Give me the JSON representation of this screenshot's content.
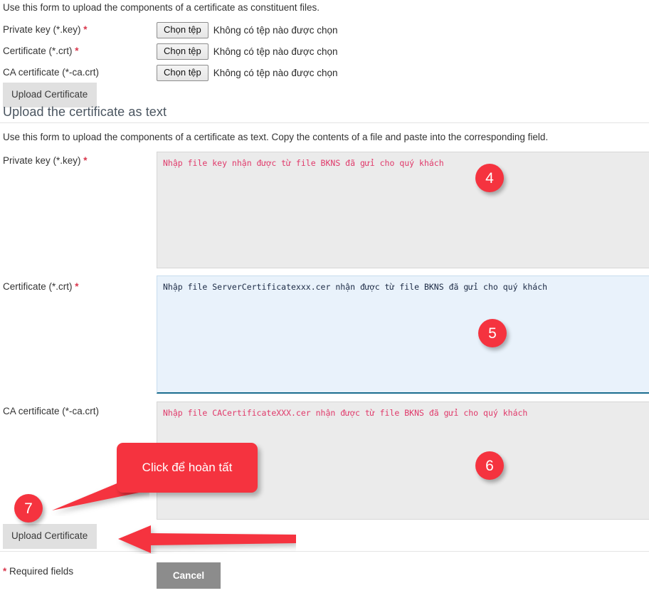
{
  "file_upload_section": {
    "intro": "Use this form to upload the components of a certificate as constituent files.",
    "rows": [
      {
        "label": "Private key (*.key)",
        "required": true,
        "button": "Chọn tệp",
        "status": "Không có tệp nào được chọn"
      },
      {
        "label": "Certificate (*.crt)",
        "required": true,
        "button": "Chọn tệp",
        "status": "Không có tệp nào được chọn"
      },
      {
        "label": "CA certificate (*-ca.crt)",
        "required": false,
        "button": "Chọn tệp",
        "status": "Không có tệp nào được chọn"
      }
    ],
    "submit_label": "Upload Certificate"
  },
  "text_upload_section": {
    "heading": "Upload the certificate as text",
    "intro": "Use this form to upload the components of a certificate as text. Copy the contents of a file and paste into the corresponding field.",
    "fields": [
      {
        "label": "Private key (*.key)",
        "required": true,
        "value": "",
        "placeholder": "Nhập file key nhận được từ file BKNS đã gửi cho quý khách",
        "state": "normal"
      },
      {
        "label": "Certificate (*.crt)",
        "required": true,
        "value": "",
        "placeholder": "Nhập file ServerCertificatexxx.cer nhận được từ file BKNS đã gửi cho quý khách",
        "state": "focused"
      },
      {
        "label": "CA certificate (*-ca.crt)",
        "required": false,
        "value": "",
        "placeholder": "Nhập file CACertificateXXX.cer nhận được từ file BKNS đã gửi cho quý khách",
        "state": "normal"
      }
    ],
    "submit_label": "Upload Certificate"
  },
  "footer": {
    "required_note_star": "*",
    "required_note_text": " Required fields",
    "cancel_label": "Cancel"
  },
  "annotations": {
    "accent_color": "#f5333f",
    "badges": [
      {
        "number": "4"
      },
      {
        "number": "5"
      },
      {
        "number": "6"
      },
      {
        "number": "7"
      }
    ],
    "callout_text": "Click để hoàn tất"
  },
  "colors": {
    "badge_red": "#f5333f",
    "required_star_red": "#d9364c",
    "placeholder_pink": "#e0396a",
    "placeholder_dark": "#1c2a45",
    "textarea_gray": "#ebebeb",
    "textarea_blue": "#e9f2fb",
    "focus_border_teal": "#1b6d8f",
    "button_gray": "#e0e0e0",
    "cancel_gray": "#8c8c8c",
    "heading_slate": "#4a5560"
  }
}
